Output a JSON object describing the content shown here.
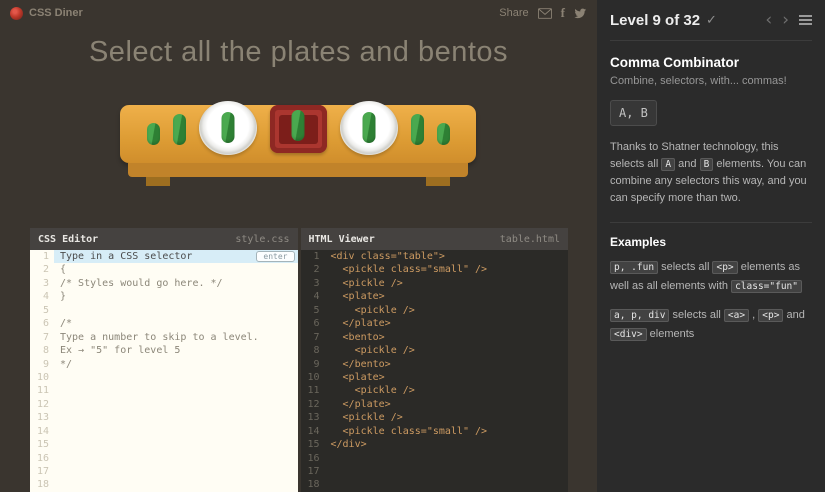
{
  "top_bar": {
    "app_name": "CSS Diner",
    "share_label": "Share"
  },
  "main": {
    "title": "Select all the plates and bentos"
  },
  "scene": {
    "items": [
      {
        "type": "pickle",
        "size": "small"
      },
      {
        "type": "pickle"
      },
      {
        "type": "plate",
        "child": "pickle"
      },
      {
        "type": "bento",
        "child": "pickle"
      },
      {
        "type": "plate",
        "child": "pickle"
      },
      {
        "type": "pickle"
      },
      {
        "type": "pickle",
        "size": "small"
      }
    ]
  },
  "css_editor": {
    "title": "CSS Editor",
    "filename": "style.css",
    "input_placeholder": "Type in a CSS selector",
    "enter_button": "enter",
    "code_lines": [
      "{",
      "/* Styles would go here. */",
      "}",
      "",
      "/*",
      "Type a number to skip to a level.",
      "Ex → \"5\" for level 5",
      "*/",
      "",
      "",
      "",
      "",
      "",
      "",
      "",
      "",
      ""
    ]
  },
  "html_viewer": {
    "title": "HTML Viewer",
    "filename": "table.html",
    "code_lines": [
      "<div class=\"table\">",
      "  <pickle class=\"small\" />",
      "  <pickle />",
      "  <plate>",
      "    <pickle />",
      "  </plate>",
      "  <bento>",
      "    <pickle />",
      "  </bento>",
      "  <plate>",
      "    <pickle />",
      "  </plate>",
      "  <pickle />",
      "  <pickle class=\"small\" />",
      "</div>",
      "",
      "",
      ""
    ]
  },
  "sidebar": {
    "level_label": "Level 9 of 32",
    "check_icon": "✓",
    "prev_icon": "‹",
    "next_icon": "›",
    "lesson_title": "Comma Combinator",
    "lesson_subtitle": "Combine, selectors, with... commas!",
    "syntax": "A, B",
    "description": [
      {
        "text": "Thanks to Shatner technology, this selects all "
      },
      {
        "code": "A"
      },
      {
        "text": " and "
      },
      {
        "code": "B"
      },
      {
        "text": " elements. You can combine any selectors this way, and you can specify more than two."
      }
    ],
    "examples_title": "Examples",
    "examples": [
      [
        {
          "code": "p, .fun"
        },
        {
          "text": " selects all "
        },
        {
          "code": "<p>"
        },
        {
          "text": " elements as well as all elements with "
        },
        {
          "code": "class=\"fun\""
        }
      ],
      [
        {
          "code": "a, p, div"
        },
        {
          "text": " selects all "
        },
        {
          "code": "<a>"
        },
        {
          "text": " , "
        },
        {
          "code": "<p>"
        },
        {
          "text": " and "
        },
        {
          "code": "<div>"
        },
        {
          "text": " elements"
        }
      ]
    ]
  },
  "colors": {
    "table_orange": "#dd9c34",
    "pickle_green": "#4aa94f",
    "bento_red": "#ab362f",
    "input_highlight_blue": "#d7edf7",
    "code_tan": "#cd9b62"
  }
}
